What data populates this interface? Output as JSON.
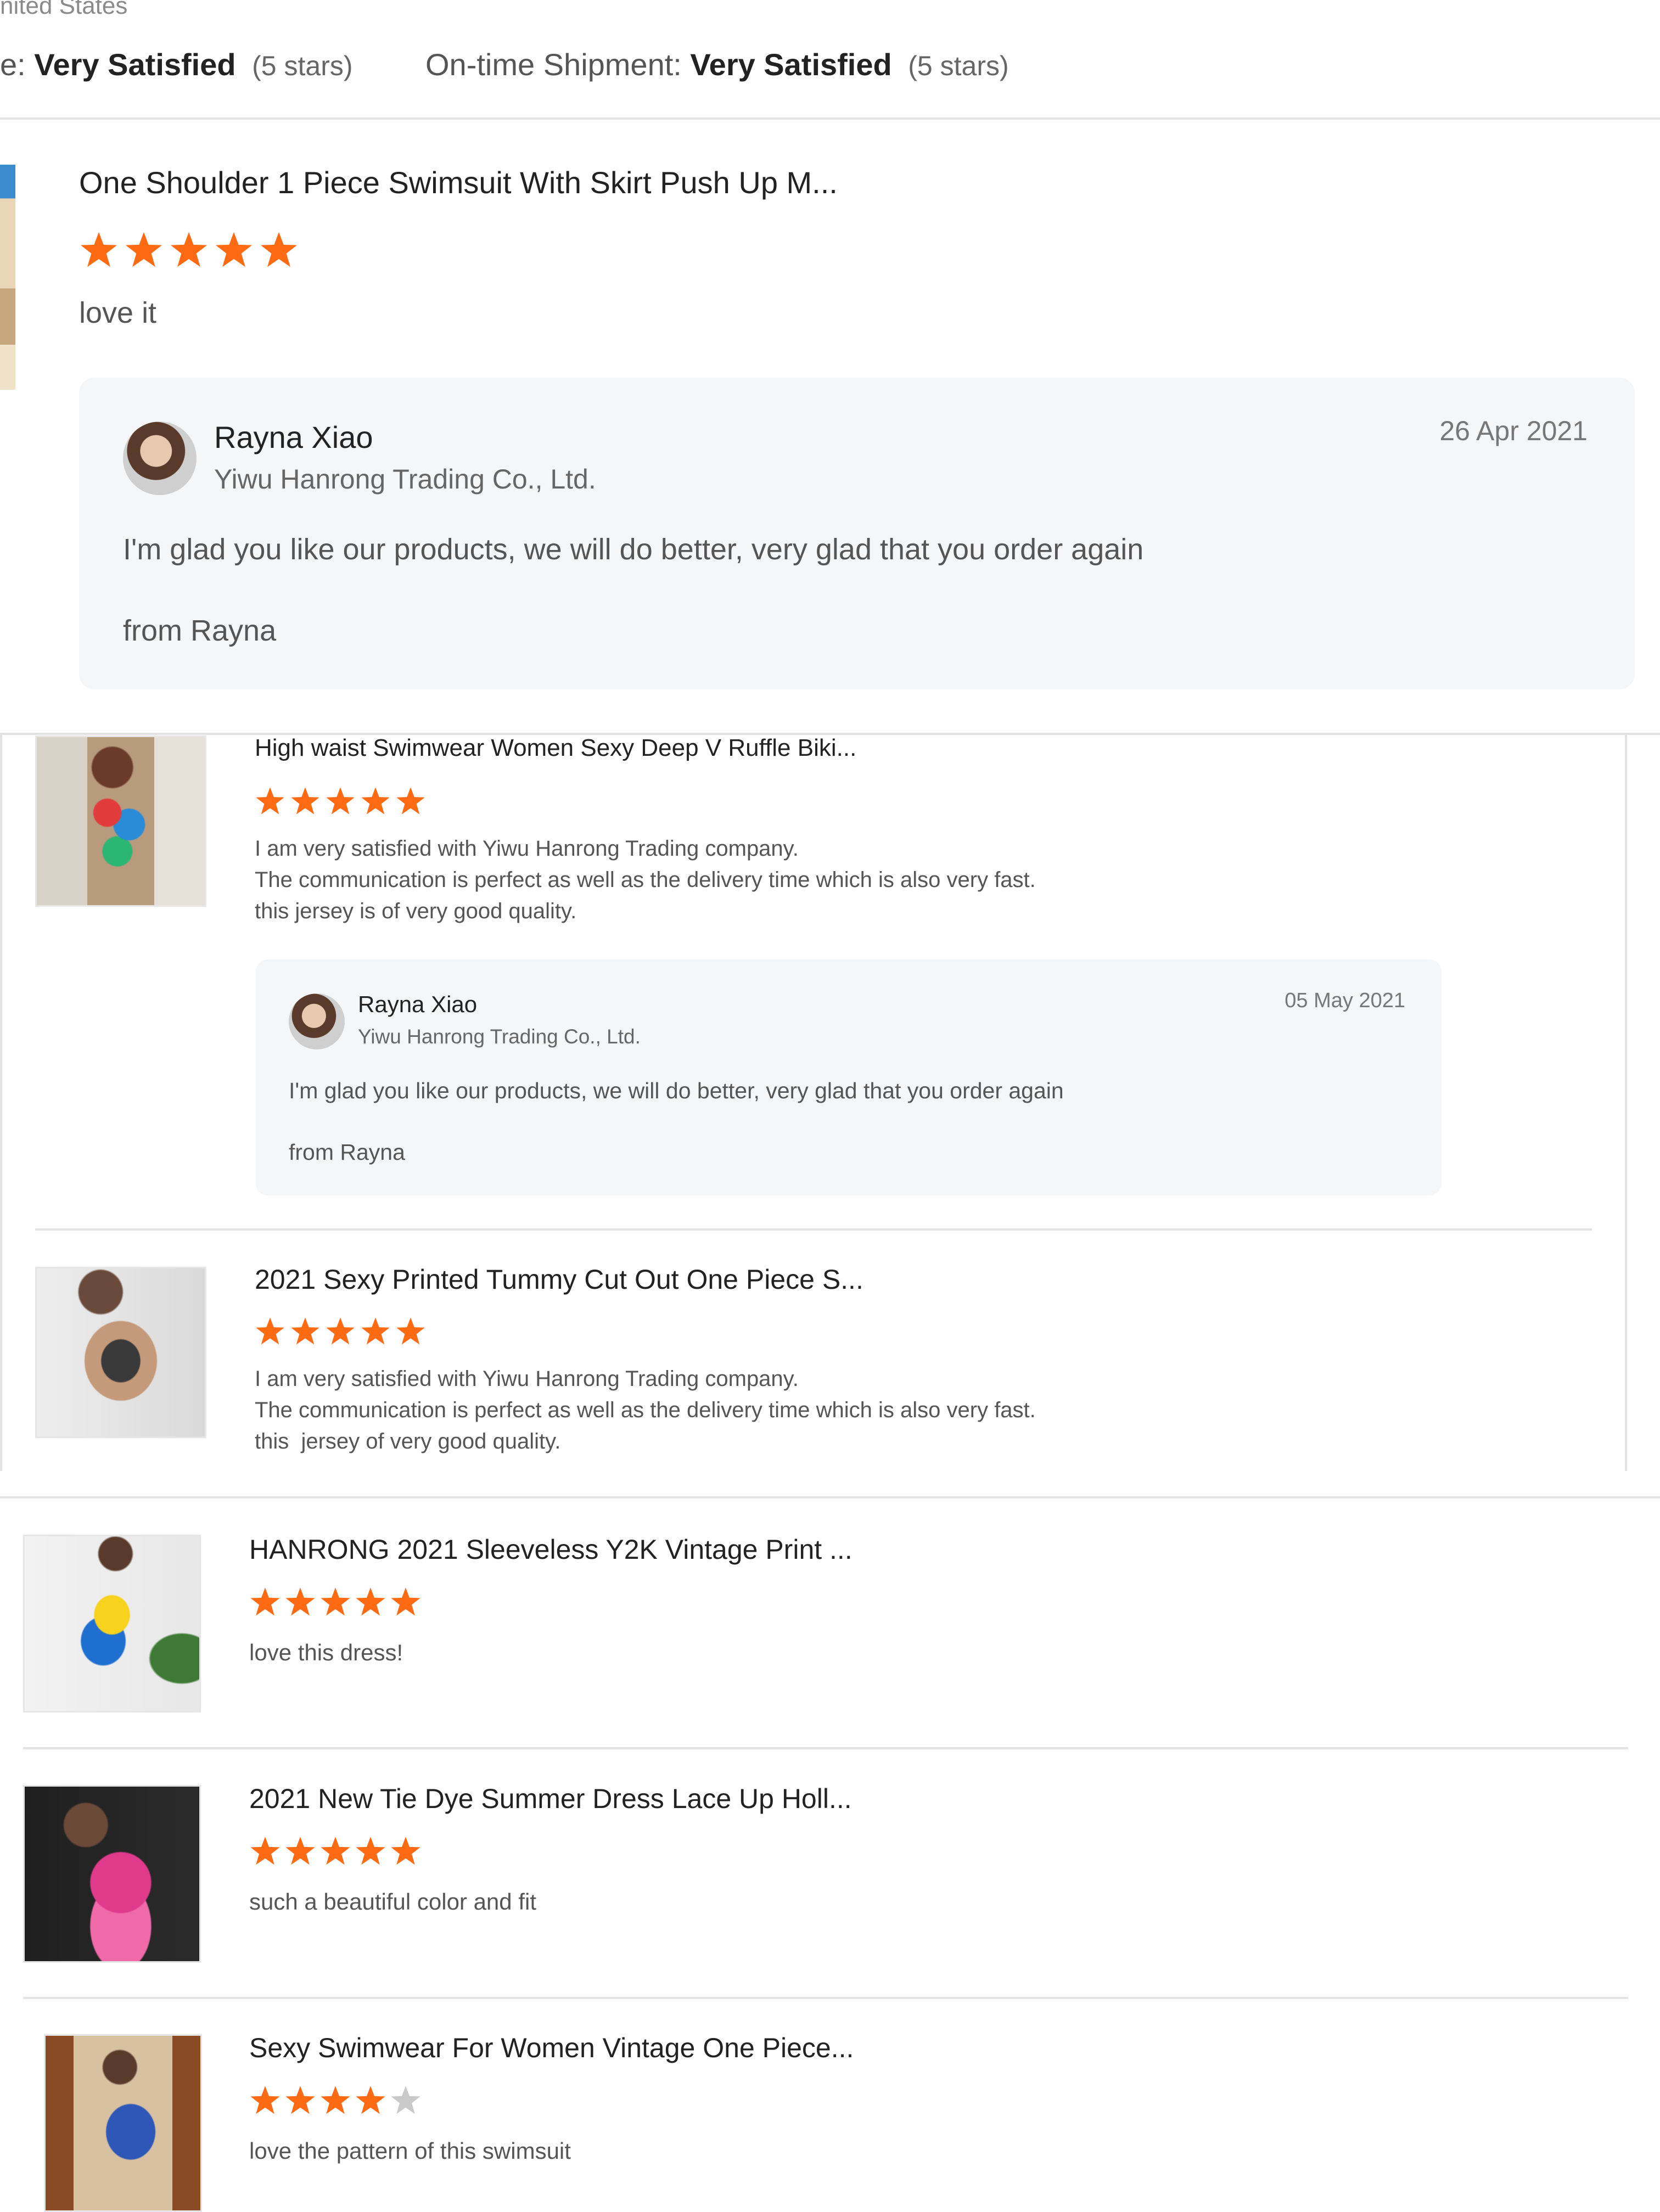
{
  "header": {
    "country": "nited States",
    "ratings": [
      {
        "label": "e:",
        "value": "Very Satisfied",
        "stars_text": "(5 stars)"
      },
      {
        "label": "On-time Shipment:",
        "value": "Very Satisfied",
        "stars_text": "(5 stars)"
      }
    ]
  },
  "reviews": [
    {
      "product": "One Shoulder 1 Piece Swimsuit With Skirt Push Up M...",
      "rating": 5,
      "text": [
        "love it"
      ],
      "reply": {
        "name": "Rayna Xiao",
        "company": "Yiwu Hanrong Trading Co., Ltd.",
        "date": "26 Apr 2021",
        "message": "I'm glad you like our products, we will do better, very glad that you order again",
        "signature": "from Rayna"
      }
    },
    {
      "product": "High waist Swimwear Women Sexy Deep V Ruffle Biki...",
      "rating": 5,
      "text": [
        "I am very satisfied with Yiwu Hanrong Trading company.",
        "The communication is perfect as well as the delivery time which is also very fast.",
        "this jersey is of very good quality."
      ],
      "reply": {
        "name": "Rayna Xiao",
        "company": "Yiwu Hanrong Trading Co., Ltd.",
        "date": "05 May 2021",
        "message": "I'm glad you like our products, we will do better, very glad that you order again",
        "signature": "from Rayna"
      }
    },
    {
      "product": "2021 Sexy Printed Tummy Cut Out One Piece S...",
      "rating": 5,
      "text": [
        "I am very satisfied with Yiwu Hanrong Trading company.",
        "The communication is perfect as well as the delivery time which is also very fast.",
        "this  jersey of very good quality."
      ]
    },
    {
      "product": "HANRONG 2021 Sleeveless Y2K Vintage Print ...",
      "rating": 5,
      "text": [
        "love this dress!"
      ]
    },
    {
      "product": "2021 New Tie Dye Summer Dress Lace Up Holl...",
      "rating": 5,
      "text": [
        "such a beautiful color and fit"
      ]
    },
    {
      "product": "Sexy Swimwear For Women Vintage One Piece...",
      "rating": 4,
      "text": [
        "love the pattern of this swimsuit"
      ]
    }
  ],
  "colors": {
    "star_filled": "#ff6a13",
    "star_empty": "#c9c9c9",
    "reply_bg": "#f5f6f7",
    "divider": "#e3e3e3"
  }
}
